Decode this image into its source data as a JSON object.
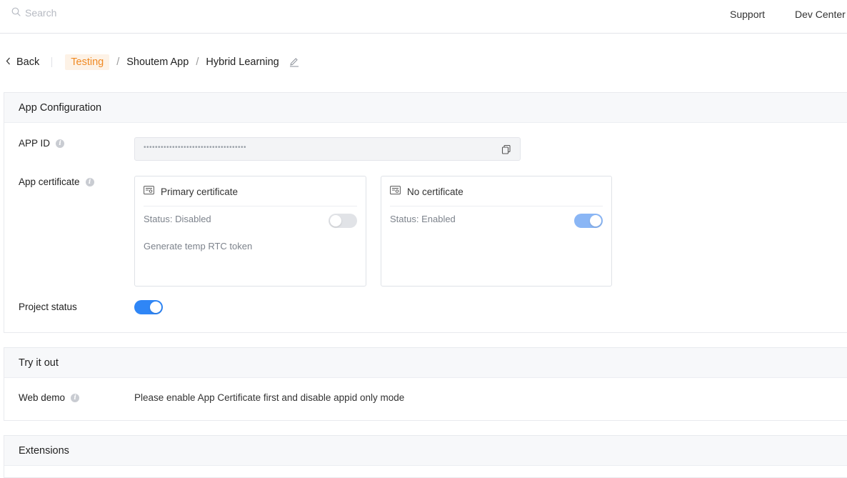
{
  "topbar": {
    "search_placeholder": "Search",
    "support_label": "Support",
    "dev_center_label": "Dev Center"
  },
  "breadcrumb": {
    "back_label": "Back",
    "tag": "Testing",
    "items": [
      "Shoutem App",
      "Hybrid Learning"
    ],
    "separator": "/"
  },
  "app_config": {
    "title": "App Configuration",
    "app_id_label": "APP ID",
    "app_id_masked": "••••••••••••••••••••••••••••••••••••",
    "app_certificate_label": "App certificate",
    "certificates": [
      {
        "title": "Primary certificate",
        "status": "Status: Disabled",
        "enabled": false,
        "link": "Generate temp RTC token"
      },
      {
        "title": "No certificate",
        "status": "Status: Enabled",
        "enabled": true
      }
    ],
    "project_status_label": "Project status",
    "project_status_on": true
  },
  "try_it_out": {
    "title": "Try it out",
    "web_demo_label": "Web demo",
    "web_demo_text": "Please enable App Certificate first and disable appid only mode"
  },
  "extensions": {
    "title": "Extensions"
  },
  "colors": {
    "accent_blue": "#2f86f6",
    "tag_orange": "#f08a24",
    "tag_bg": "#fdf2e6"
  },
  "icons": {
    "search": "search-icon",
    "back": "chevron-left-icon",
    "edit": "pencil-icon",
    "info": "info-icon",
    "copy": "copy-icon",
    "certificate": "certificate-icon"
  }
}
